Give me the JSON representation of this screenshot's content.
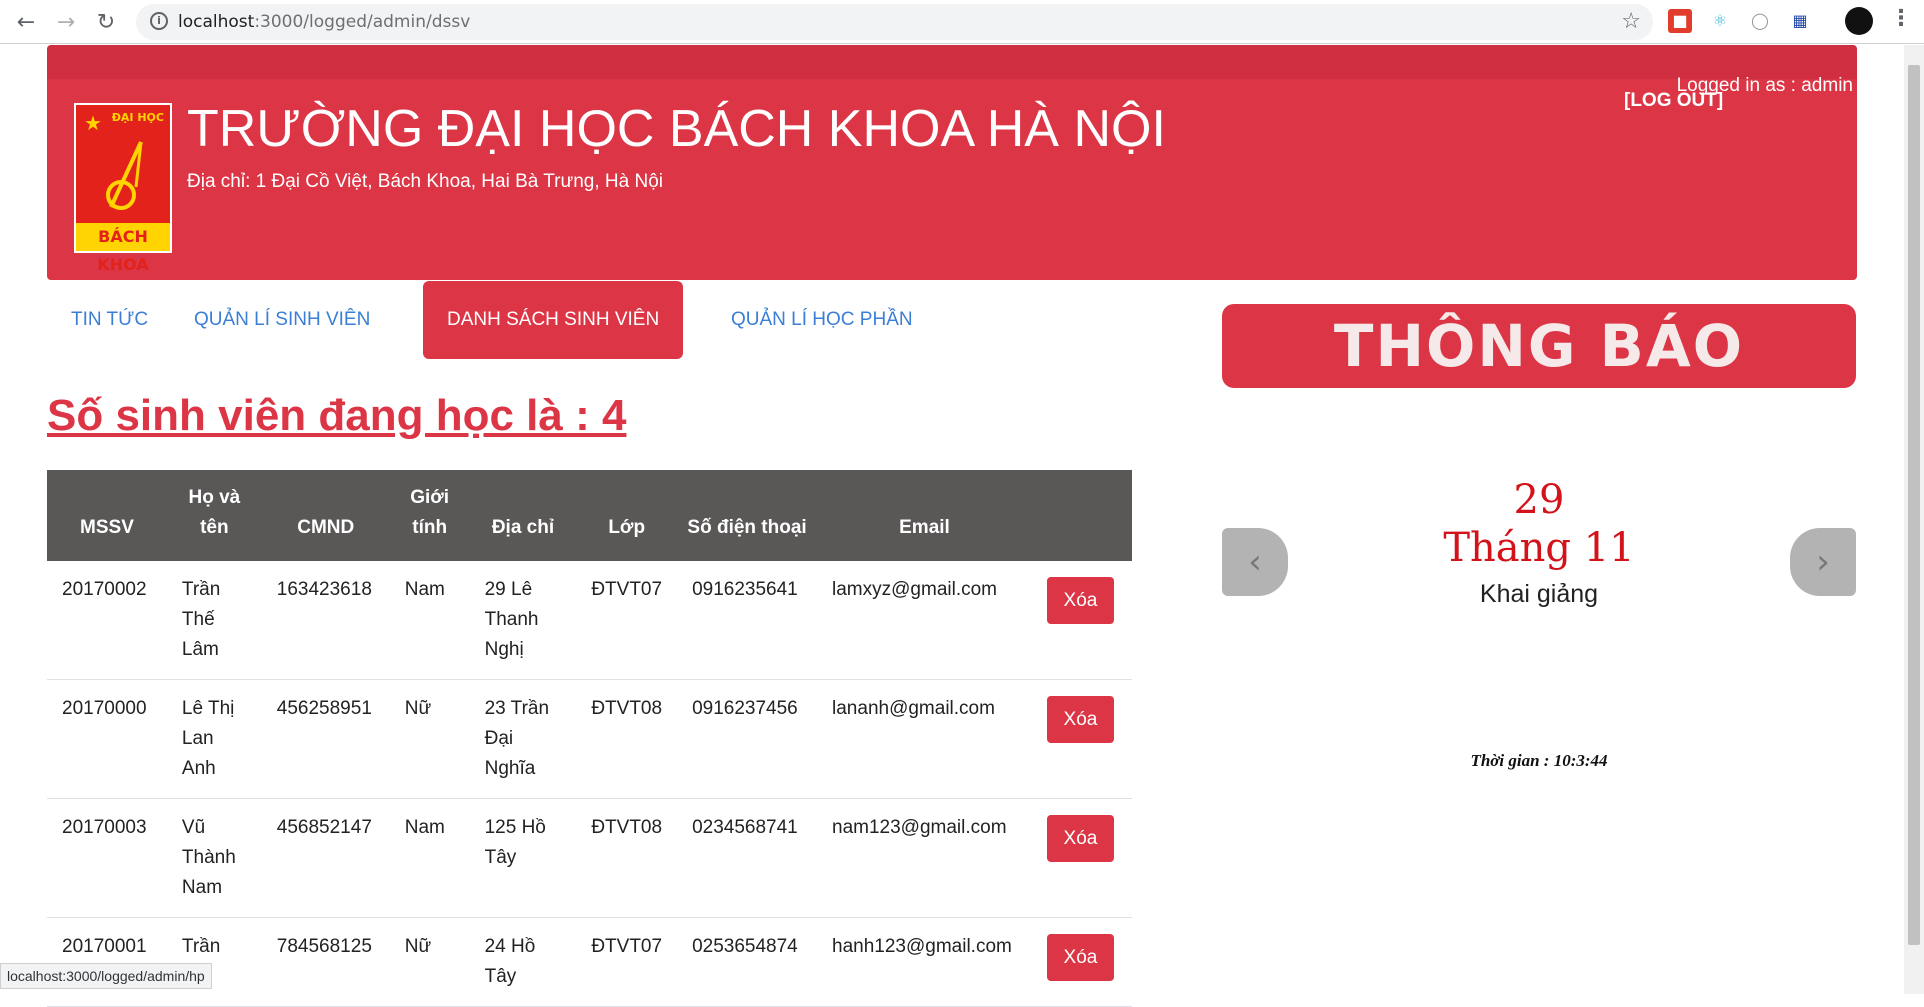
{
  "browser": {
    "url_host": "localhost",
    "url_path": ":3000/logged/admin/dssv",
    "status_url": "localhost:3000/logged/admin/hp"
  },
  "header": {
    "logo_top": "ĐẠI HỌC",
    "logo_bottom": "BÁCH KHOA",
    "school_name": "TRƯỜNG ĐẠI HỌC BÁCH KHOA HÀ NỘI",
    "address": "Địa chỉ: 1 Đại Cồ Việt, Bách Khoa, Hai Bà Trưng, Hà Nội",
    "logged_in": "Logged in as : admin",
    "logout": "[LOG OUT]"
  },
  "tabs": [
    {
      "label": "TIN TỨC"
    },
    {
      "label": "QUẢN LÍ SINH VIÊN"
    },
    {
      "label": "DANH SÁCH SINH VIÊN"
    },
    {
      "label": "QUẢN LÍ HỌC PHẦN"
    }
  ],
  "main": {
    "count_title": "Số sinh viên đang học là : 4",
    "columns": [
      "MSSV",
      "Họ và tên",
      "CMND",
      "Giới tính",
      "Địa chỉ",
      "Lớp",
      "Số điện thoại",
      "Email",
      ""
    ],
    "delete_label": "Xóa",
    "rows": [
      {
        "mssv": "20170002",
        "name": "Trần Thế Lâm",
        "cmnd": "163423618",
        "gender": "Nam",
        "address": "29 Lê Thanh Nghị",
        "class": "ĐTVT07",
        "phone": "0916235641",
        "email": "lamxyz@gmail.com"
      },
      {
        "mssv": "20170000",
        "name": "Lê Thị Lan Anh",
        "cmnd": "456258951",
        "gender": "Nữ",
        "address": "23 Trần Đại Nghĩa",
        "class": "ĐTVT08",
        "phone": "0916237456",
        "email": "lananh@gmail.com"
      },
      {
        "mssv": "20170003",
        "name": "Vũ Thành Nam",
        "cmnd": "456852147",
        "gender": "Nam",
        "address": "125 Hồ Tây",
        "class": "ĐTVT08",
        "phone": "0234568741",
        "email": "nam123@gmail.com"
      },
      {
        "mssv": "20170001",
        "name": "Trần",
        "cmnd": "784568125",
        "gender": "Nữ",
        "address": "24 Hồ Tây",
        "class": "ĐTVT07",
        "phone": "0253654874",
        "email": "hanh123@gmail.com"
      }
    ]
  },
  "notice": {
    "title": "THÔNG BÁO",
    "day": "29",
    "month": "Tháng 11",
    "event": "Khai giảng",
    "time": "Thời gian : 10:3:44"
  },
  "colors": {
    "brand_red": "#dc3545",
    "table_header": "#5a5757",
    "link_blue": "#3a7fd5"
  }
}
